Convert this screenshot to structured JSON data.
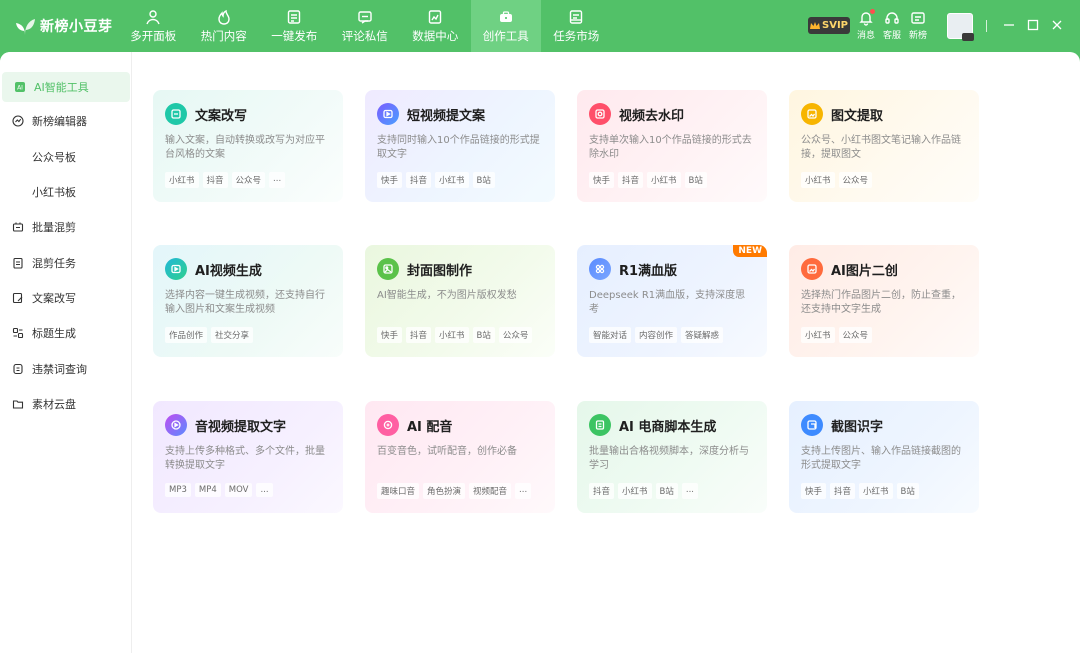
{
  "app": {
    "name": "新榜小豆芽"
  },
  "nav": [
    {
      "label": "多开面板",
      "icon": "multi-panel-icon"
    },
    {
      "label": "热门内容",
      "icon": "flame-icon"
    },
    {
      "label": "一键发布",
      "icon": "publish-icon"
    },
    {
      "label": "评论私信",
      "icon": "message-icon"
    },
    {
      "label": "数据中心",
      "icon": "data-center-icon"
    },
    {
      "label": "创作工具",
      "icon": "toolbox-icon",
      "active": true
    },
    {
      "label": "任务市场",
      "icon": "task-market-icon"
    }
  ],
  "topbar_tools": {
    "vip_badge": "SVIP",
    "notifications": "消息",
    "support": "客服",
    "new_features": "新榜"
  },
  "sidebar": {
    "items": [
      {
        "label": "AI智能工具",
        "icon": "ai-icon",
        "active": true
      },
      {
        "label": "新榜编辑器",
        "icon": "editor-icon"
      },
      {
        "label": "公众号板",
        "icon": ""
      },
      {
        "label": "小红书板",
        "icon": ""
      },
      {
        "label": "批量混剪",
        "icon": "scissors-icon"
      },
      {
        "label": "混剪任务",
        "icon": "task-icon"
      },
      {
        "label": "文案改写",
        "icon": "rewrite-icon"
      },
      {
        "label": "标题生成",
        "icon": "title-icon"
      },
      {
        "label": "违禁词查询",
        "icon": "search-doc-icon"
      },
      {
        "label": "素材云盘",
        "icon": "folder-icon"
      }
    ]
  },
  "cards": [
    {
      "title": "文案改写",
      "desc": "输入文案，自动转换或改写为对应平台风格的文案",
      "tags": [
        "小红书",
        "抖音",
        "公众号",
        "..."
      ],
      "icon": "rewrite-icon",
      "accent": "#1fc8a8"
    },
    {
      "title": "短视频提文案",
      "desc": "支持同时输入10个作品链接的形式提取文字",
      "tags": [
        "快手",
        "抖音",
        "小红书",
        "B站"
      ],
      "icon": "video-text-icon",
      "accent": "#7b5cff"
    },
    {
      "title": "视频去水印",
      "desc": "支持单次输入10个作品链接的形式去除水印",
      "tags": [
        "快手",
        "抖音",
        "小红书",
        "B站"
      ],
      "icon": "watermark-icon",
      "accent": "#ff4f6a"
    },
    {
      "title": "图文提取",
      "desc": "公众号、小红书图文笔记输入作品链接，提取图文",
      "tags": [
        "小红书",
        "公众号"
      ],
      "icon": "image-text-icon",
      "accent": "#f7b500"
    },
    {
      "title": "AI视频生成",
      "desc": "选择内容一键生成视频，还支持自行输入图片和文案生成视频",
      "tags": [
        "作品创作",
        "社交分享"
      ],
      "icon": "video-gen-icon",
      "accent": "#22b7d8"
    },
    {
      "title": "封面图制作",
      "desc": "AI智能生成，不为图片版权发愁",
      "tags": [
        "快手",
        "抖音",
        "小红书",
        "B站",
        "公众号"
      ],
      "icon": "cover-icon",
      "accent": "#5bc24a"
    },
    {
      "title": "R1满血版",
      "desc": "Deepseek R1满血版，支持深度思考",
      "tags": [
        "智能对话",
        "内容创作",
        "答疑解惑"
      ],
      "icon": "grid-icon",
      "accent": "#5a8bff",
      "badge": "NEW"
    },
    {
      "title": "AI图片二创",
      "desc": "选择热门作品图片二创，防止查重，还支持中文字生成",
      "tags": [
        "小红书",
        "公众号"
      ],
      "icon": "image-remix-icon",
      "accent": "#ff6b3d"
    },
    {
      "title": "音视频提取文字",
      "desc": "支持上传多种格式、多个文件，批量转换提取文字",
      "tags": [
        "MP3",
        "MP4",
        "MOV",
        "..."
      ],
      "icon": "audio-text-icon",
      "accent": "#c04cf0"
    },
    {
      "title": "AI 配音",
      "desc": "百变音色，试听配音，创作必备",
      "tags": [
        "趣味口音",
        "角色扮演",
        "视频配音",
        "..."
      ],
      "icon": "voice-icon",
      "accent": "#ff5fa2"
    },
    {
      "title": "AI 电商脚本生成",
      "desc": "批量输出合格视频脚本，深度分析与学习",
      "tags": [
        "抖音",
        "小红书",
        "B站",
        "..."
      ],
      "icon": "script-icon",
      "accent": "#3cc463"
    },
    {
      "title": "截图识字",
      "desc": "支持上传图片、输入作品链接截图的形式提取文字",
      "tags": [
        "快手",
        "抖音",
        "小红书",
        "B站"
      ],
      "icon": "ocr-icon",
      "accent": "#3e8bff"
    }
  ]
}
